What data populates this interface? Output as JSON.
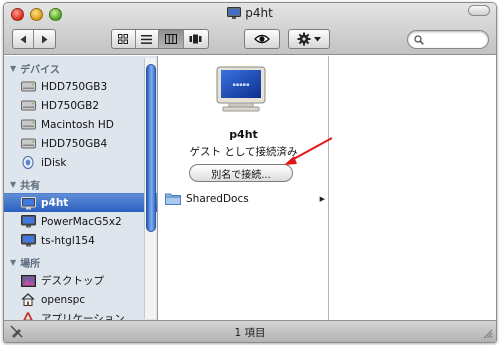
{
  "window": {
    "title": "p4ht"
  },
  "sidebar": {
    "devices": {
      "header": "デバイス",
      "items": [
        {
          "label": "HDD750GB3",
          "icon": "hard-drive-icon"
        },
        {
          "label": "HD750GB2",
          "icon": "hard-drive-icon"
        },
        {
          "label": "Macintosh HD",
          "icon": "hard-drive-icon"
        },
        {
          "label": "HDD750GB4",
          "icon": "hard-drive-icon"
        },
        {
          "label": "iDisk",
          "icon": "idisk-icon"
        }
      ]
    },
    "shared": {
      "header": "共有",
      "items": [
        {
          "label": "p4ht",
          "icon": "computer-monitor-icon",
          "selected": true
        },
        {
          "label": "PowerMacG5x2",
          "icon": "computer-monitor-icon"
        },
        {
          "label": "ts-htgl154",
          "icon": "computer-monitor-icon"
        }
      ]
    },
    "places": {
      "header": "場所",
      "items": [
        {
          "label": "デスクトップ",
          "icon": "desktop-icon"
        },
        {
          "label": "openspc",
          "icon": "home-icon"
        },
        {
          "label": "アプリケーション",
          "icon": "applications-icon"
        }
      ]
    }
  },
  "main": {
    "share_name": "p4ht",
    "status": "ゲスト として接続済み",
    "connect_button": "別名で接続...",
    "folders": [
      {
        "label": "SharedDocs",
        "icon": "folder-icon"
      }
    ]
  },
  "statusbar": {
    "text": "1 項目"
  },
  "colors": {
    "selection": "#2a60c0",
    "sidebar_bg": "#dfe5ec",
    "annotation_arrow": "#e01818"
  }
}
